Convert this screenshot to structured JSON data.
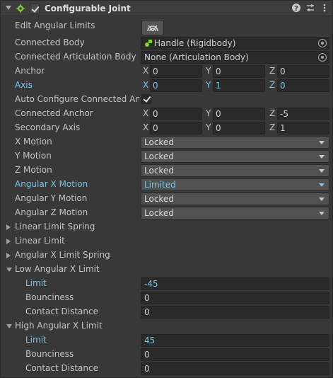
{
  "component": {
    "title": "Configurable Joint",
    "header_icons": [
      "help-icon",
      "presets-icon",
      "more-icon"
    ],
    "accent_modified": "#7bc4e6"
  },
  "edit_angular_limits": {
    "label": "Edit Angular Limits",
    "button_icon": "edit-limits-icon"
  },
  "connected_body": {
    "label": "Connected Body",
    "value": "Handle (Rigidbody)"
  },
  "connected_articulation_body": {
    "label": "Connected Articulation Body",
    "value": "None (Articulation Body)"
  },
  "anchor": {
    "label": "Anchor",
    "x_label": "X",
    "y_label": "Y",
    "z_label": "Z",
    "x": "0",
    "y": "0",
    "z": "0"
  },
  "axis": {
    "label": "Axis",
    "x_label": "X",
    "y_label": "Y",
    "z_label": "Z",
    "x": "0",
    "y": "1",
    "z": "0"
  },
  "auto_configure": {
    "label": "Auto Configure Connected Anch",
    "checked": true
  },
  "connected_anchor": {
    "label": "Connected Anchor",
    "x_label": "X",
    "y_label": "Y",
    "z_label": "Z",
    "x": "0",
    "y": "0",
    "z": "-5"
  },
  "secondary_axis": {
    "label": "Secondary Axis",
    "x_label": "X",
    "y_label": "Y",
    "z_label": "Z",
    "x": "0",
    "y": "0",
    "z": "1"
  },
  "motions": [
    {
      "label": "X Motion",
      "value": "Locked"
    },
    {
      "label": "Y Motion",
      "value": "Locked"
    },
    {
      "label": "Z Motion",
      "value": "Locked"
    },
    {
      "label": "Angular X Motion",
      "value": "Limited"
    },
    {
      "label": "Angular Y Motion",
      "value": "Locked"
    },
    {
      "label": "Angular Z Motion",
      "value": "Locked"
    }
  ],
  "foldouts": [
    {
      "label": "Linear Limit Spring"
    },
    {
      "label": "Linear Limit"
    },
    {
      "label": "Angular X Limit Spring"
    }
  ],
  "low_angular_x_limit": {
    "label": "Low Angular X Limit",
    "limit_label": "Limit",
    "limit": "-45",
    "bounciness_label": "Bounciness",
    "bounciness": "0",
    "contact_distance_label": "Contact Distance",
    "contact_distance": "0"
  },
  "high_angular_x_limit": {
    "label": "High Angular X Limit",
    "limit_label": "Limit",
    "limit": "45",
    "bounciness_label": "Bounciness",
    "bounciness": "0",
    "contact_distance_label": "Contact Distance",
    "contact_distance": "0"
  }
}
